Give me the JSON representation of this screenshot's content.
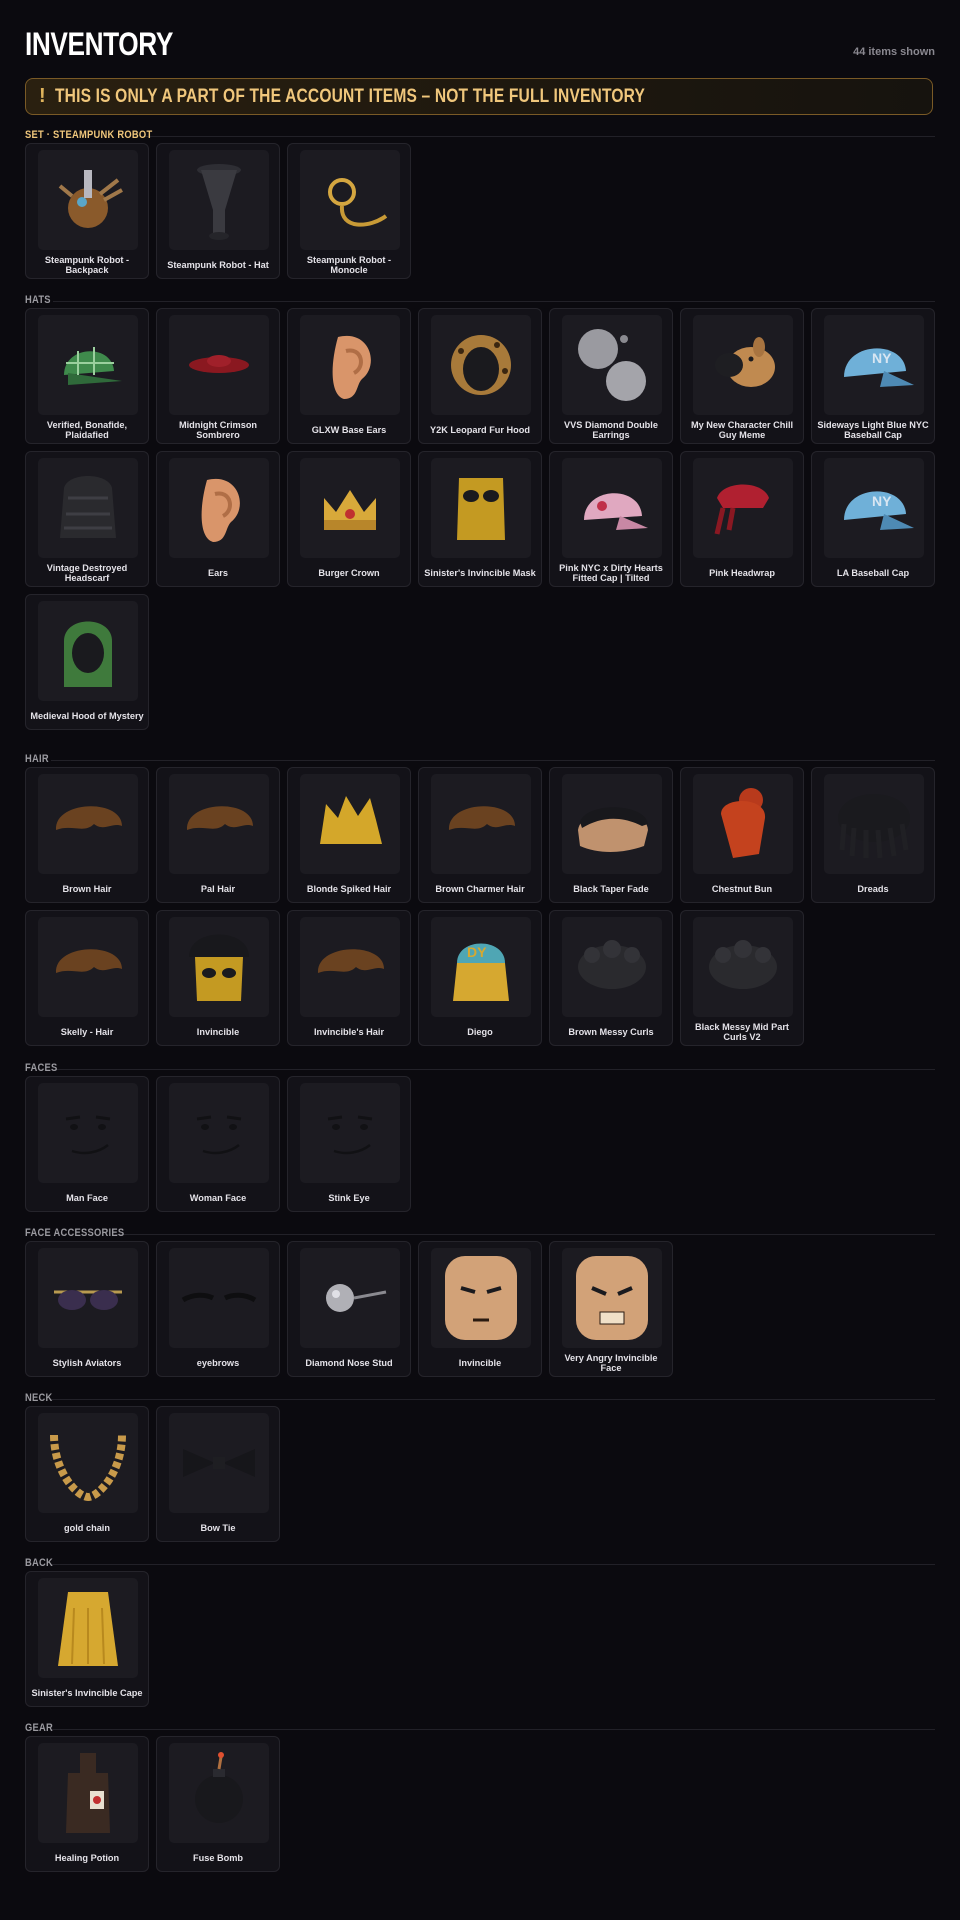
{
  "header": {
    "title": "INVENTORY",
    "count": "44 items shown"
  },
  "notice": {
    "icon": "!",
    "text": "THIS IS ONLY A PART OF THE ACCOUNT ITEMS – NOT THE FULL INVENTORY"
  },
  "sections": [
    {
      "label": "SET · STEAMPUNK ROBOT",
      "accent": true,
      "items": [
        {
          "name": "Steampunk Robot - Backpack",
          "icon": "steampunk-backpack-icon"
        },
        {
          "name": "Steampunk Robot - Hat",
          "icon": "top-hat-icon"
        },
        {
          "name": "Steampunk Robot - Monocle",
          "icon": "monocle-icon"
        }
      ]
    },
    {
      "label": "HATS",
      "accent": false,
      "items": [
        {
          "name": "Verified, Bonafide, Plaidafied",
          "icon": "plaid-cap-icon"
        },
        {
          "name": "Midnight Crimson Sombrero",
          "icon": "sombrero-icon"
        },
        {
          "name": "GLXW Base Ears",
          "icon": "ear-icon"
        },
        {
          "name": "Y2K Leopard Fur Hood",
          "icon": "fur-hood-icon"
        },
        {
          "name": "VVS Diamond Double Earrings",
          "icon": "diamond-earrings-icon"
        },
        {
          "name": "My New Character Chill Guy Meme",
          "icon": "dog-head-icon"
        },
        {
          "name": "Sideways Light Blue NYC Baseball Cap",
          "icon": "baseball-cap-icon"
        },
        {
          "name": "Vintage Destroyed Headscarf",
          "icon": "headscarf-icon"
        },
        {
          "name": "Ears",
          "icon": "ear-icon"
        },
        {
          "name": "Burger Crown",
          "icon": "crown-icon"
        },
        {
          "name": "Sinister's Invincible Mask",
          "icon": "mask-icon"
        },
        {
          "name": "Pink NYC x Dirty Hearts Fitted Cap | Tilted",
          "icon": "fitted-cap-icon"
        },
        {
          "name": "Pink Headwrap",
          "icon": "headwrap-icon"
        },
        {
          "name": "LA Baseball Cap",
          "icon": "baseball-cap-icon"
        },
        {
          "name": "Medieval Hood of Mystery",
          "icon": "hood-icon"
        }
      ]
    },
    {
      "label": "HAIR",
      "accent": false,
      "items": [
        {
          "name": "Brown Hair",
          "icon": "hair-icon"
        },
        {
          "name": "Pal Hair",
          "icon": "hair-icon"
        },
        {
          "name": "Blonde Spiked Hair",
          "icon": "spiked-hair-icon"
        },
        {
          "name": "Brown Charmer Hair",
          "icon": "hair-icon"
        },
        {
          "name": "Black Taper Fade",
          "icon": "fade-hair-icon"
        },
        {
          "name": "Chestnut Bun",
          "icon": "bun-hair-icon"
        },
        {
          "name": "Dreads",
          "icon": "dreads-icon"
        },
        {
          "name": "Skelly - Hair",
          "icon": "hair-icon"
        },
        {
          "name": "Invincible",
          "icon": "masked-hair-icon"
        },
        {
          "name": "Invincible's Hair",
          "icon": "hair-icon"
        },
        {
          "name": "Diego",
          "icon": "cap-hair-icon"
        },
        {
          "name": "Brown Messy Curls",
          "icon": "curls-icon"
        },
        {
          "name": "Black Messy Mid Part Curls V2",
          "icon": "curls-icon"
        }
      ]
    },
    {
      "label": "FACES",
      "accent": false,
      "items": [
        {
          "name": "Man Face",
          "icon": "face-icon"
        },
        {
          "name": "Woman Face",
          "icon": "face-icon"
        },
        {
          "name": "Stink Eye",
          "icon": "face-icon"
        }
      ]
    },
    {
      "label": "FACE ACCESSORIES",
      "accent": false,
      "items": [
        {
          "name": "Stylish Aviators",
          "icon": "aviators-icon"
        },
        {
          "name": "eyebrows",
          "icon": "eyebrows-icon"
        },
        {
          "name": "Diamond Nose Stud",
          "icon": "nose-stud-icon"
        },
        {
          "name": "Invincible",
          "icon": "head-icon"
        },
        {
          "name": "Very Angry Invincible Face",
          "icon": "angry-head-icon"
        }
      ]
    },
    {
      "label": "NECK",
      "accent": false,
      "items": [
        {
          "name": "gold chain",
          "icon": "chain-icon"
        },
        {
          "name": "Bow Tie",
          "icon": "bow-tie-icon"
        }
      ]
    },
    {
      "label": "BACK",
      "accent": false,
      "items": [
        {
          "name": "Sinister's Invincible Cape",
          "icon": "cape-icon"
        }
      ]
    },
    {
      "label": "GEAR",
      "accent": false,
      "items": [
        {
          "name": "Healing Potion",
          "icon": "potion-icon"
        },
        {
          "name": "Fuse Bomb",
          "icon": "bomb-icon"
        }
      ]
    }
  ]
}
